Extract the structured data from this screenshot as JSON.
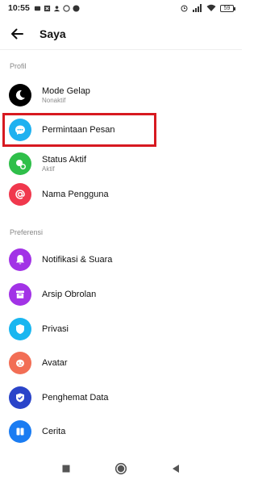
{
  "status_bar": {
    "time": "10:55",
    "battery": "59"
  },
  "header": {
    "title": "Saya"
  },
  "sections": {
    "profil_label": "Profil",
    "preferensi_label": "Preferensi"
  },
  "items": {
    "mode_gelap": {
      "label": "Mode Gelap",
      "sub": "Nonaktif",
      "color": "#000000",
      "icon": "moon-icon"
    },
    "permintaan_pesan": {
      "label": "Permintaan Pesan",
      "color": "#1fb1f0",
      "icon": "chat-bubble-icon"
    },
    "status_aktif": {
      "label": "Status Aktif",
      "sub": "Aktif",
      "color": "#2fbf4a",
      "icon": "active-status-icon"
    },
    "nama_pengguna": {
      "label": "Nama Pengguna",
      "color": "#f0384d",
      "icon": "at-icon"
    },
    "notifikasi": {
      "label": "Notifikasi & Suara",
      "color": "#a233e6",
      "icon": "bell-icon"
    },
    "arsip": {
      "label": "Arsip Obrolan",
      "color": "#a233e6",
      "icon": "archive-icon"
    },
    "privasi": {
      "label": "Privasi",
      "color": "#1ab6f0",
      "icon": "shield-icon"
    },
    "avatar": {
      "label": "Avatar",
      "color": "#f26e55",
      "icon": "avatar-face-icon"
    },
    "penghemat": {
      "label": "Penghemat Data",
      "color": "#2a44c9",
      "icon": "data-saver-icon"
    },
    "cerita": {
      "label": "Cerita",
      "color": "#1a7cf2",
      "icon": "stories-icon"
    }
  },
  "highlight_color": "#d71920"
}
